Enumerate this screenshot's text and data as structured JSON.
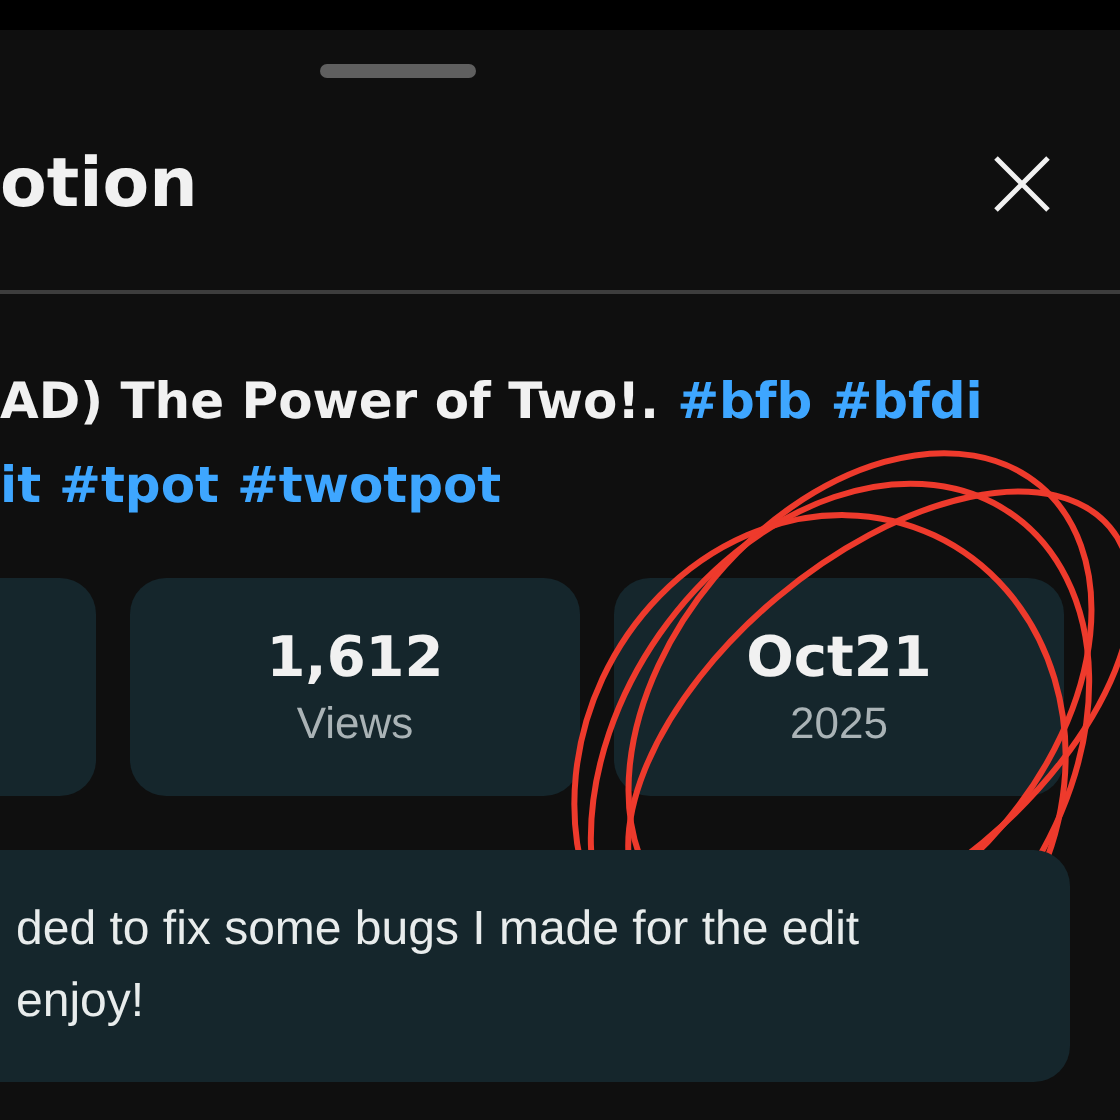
{
  "sheet": {
    "title": "otion"
  },
  "headline_lines": [
    [
      {
        "text": "AD) The Power of Two!.",
        "kind": "plain"
      },
      {
        "text": "#bfb",
        "kind": "hashtag"
      },
      {
        "text": "#bfdi",
        "kind": "hashtag"
      }
    ],
    [
      {
        "text": "it",
        "kind": "hashtag"
      },
      {
        "text": "#tpot",
        "kind": "hashtag"
      },
      {
        "text": "#twotpot",
        "kind": "hashtag"
      }
    ]
  ],
  "stats": [
    {
      "kind": "cut"
    },
    {
      "kind": "stat",
      "value": "1,612",
      "label": "Views"
    },
    {
      "kind": "stat",
      "value": "Oct21",
      "label": "2025"
    }
  ],
  "description_lines": [
    "ded to fix some bugs I made for the edit",
    "enjoy!"
  ]
}
